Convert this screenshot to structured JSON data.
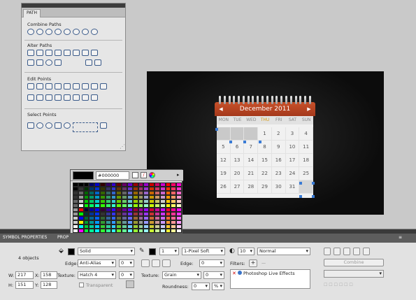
{
  "path_panel": {
    "tab": "PATH",
    "sections": [
      "Combine Paths",
      "Alter Paths",
      "Edit Points",
      "Select Points"
    ]
  },
  "calendar": {
    "title": "December 2011",
    "prev_arrow": "◀",
    "next_arrow": "▶",
    "days": [
      "MON",
      "TUE",
      "WED",
      "THU",
      "FRI",
      "SAT",
      "SUN"
    ],
    "rows": [
      [
        "",
        "",
        "",
        "1",
        "2",
        "3",
        "4"
      ],
      [
        "5",
        "6",
        "7",
        "8",
        "9",
        "10",
        "11"
      ],
      [
        "12",
        "13",
        "14",
        "15",
        "16",
        "17",
        "18"
      ],
      [
        "19",
        "20",
        "21",
        "22",
        "23",
        "24",
        "25"
      ],
      [
        "26",
        "27",
        "28",
        "29",
        "30",
        "31",
        ""
      ]
    ]
  },
  "color_picker": {
    "hex": "#000000",
    "swatch": "#000000"
  },
  "properties": {
    "tab1": "SYMBOL PROPERTIES",
    "tab2": "PROP",
    "objects": "4 objects",
    "w_label": "W:",
    "w": "217",
    "x_label": "X:",
    "x": "158",
    "h_label": "H:",
    "h": "151",
    "y_label": "Y:",
    "y": "128",
    "fill_type": "Solid",
    "edge_label": "Edge:",
    "fill_edge": "Anti-Alias",
    "fill_edge_val": "0",
    "texture_label": "Texture:",
    "fill_texture": "Hatch 4",
    "fill_texture_val": "0",
    "transparent": "Transparent",
    "stroke_size": "1",
    "stroke_type": "1-Pixel Soft",
    "stroke_edge": "0",
    "stroke_texture": "Grain",
    "stroke_texture_val": "0",
    "roundness_label": "Roundness:",
    "roundness": "0",
    "roundness_unit": "%",
    "opacity": "10",
    "blend": "Normal",
    "filters_label": "Filters:",
    "filter_item": "Photoshop Live Effects",
    "combine": "Combine"
  }
}
